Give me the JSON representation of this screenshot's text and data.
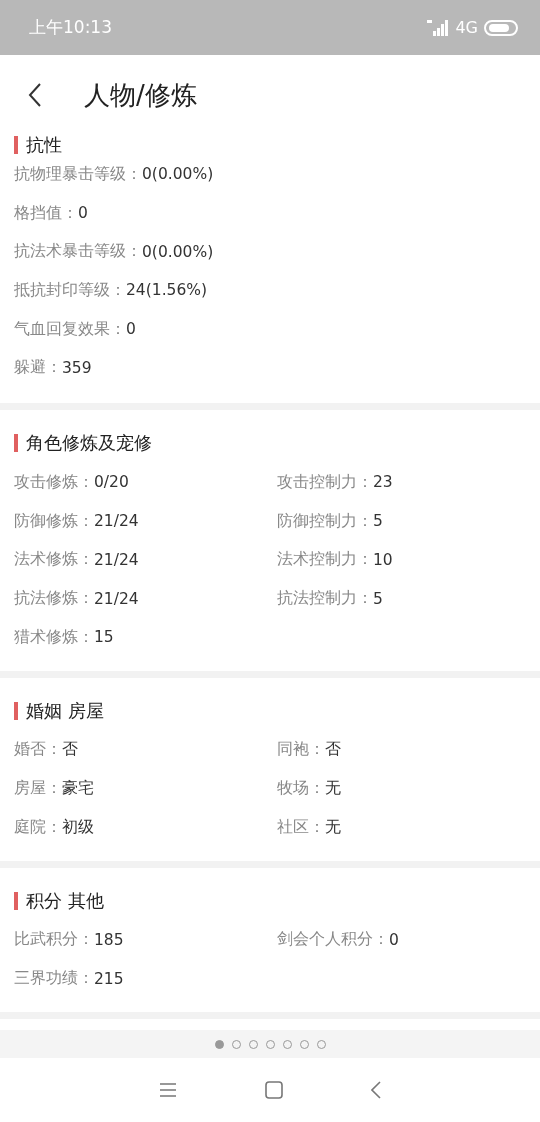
{
  "status_bar": {
    "time": "上午10:13",
    "network": "4G"
  },
  "header": {
    "title": "人物/修炼"
  },
  "sections": [
    {
      "title": "抗性",
      "kind": "list",
      "rows": [
        {
          "label": "抗物理暴击等级：",
          "value": "0(0.00%)"
        },
        {
          "label": "格挡值：",
          "value": "0"
        },
        {
          "label": "抗法术暴击等级：",
          "value": "0(0.00%)"
        },
        {
          "label": "抵抗封印等级：",
          "value": "24(1.56%)"
        },
        {
          "label": "气血回复效果：",
          "value": "0"
        },
        {
          "label": "躲避：",
          "value": "359"
        }
      ]
    },
    {
      "title": "角色修炼及宠修",
      "kind": "grid",
      "rows": [
        {
          "label": "攻击修炼：",
          "value": "0/20"
        },
        {
          "label": "攻击控制力：",
          "value": "23"
        },
        {
          "label": "防御修炼：",
          "value": "21/24"
        },
        {
          "label": "防御控制力：",
          "value": "5"
        },
        {
          "label": "法术修炼：",
          "value": "21/24"
        },
        {
          "label": "法术控制力：",
          "value": "10"
        },
        {
          "label": "抗法修炼：",
          "value": "21/24"
        },
        {
          "label": "抗法控制力：",
          "value": "5"
        },
        {
          "label": "猎术修炼：",
          "value": "15"
        }
      ]
    },
    {
      "title": "婚姻 房屋",
      "kind": "grid",
      "rows": [
        {
          "label": "婚否：",
          "value": "否"
        },
        {
          "label": "同袍：",
          "value": "否"
        },
        {
          "label": "房屋：",
          "value": "豪宅"
        },
        {
          "label": "牧场：",
          "value": "无"
        },
        {
          "label": "庭院：",
          "value": "初级"
        },
        {
          "label": "社区：",
          "value": "无"
        }
      ]
    },
    {
      "title": "积分 其他",
      "kind": "grid",
      "rows": [
        {
          "label": "比武积分：",
          "value": "185"
        },
        {
          "label": "剑会个人积分：",
          "value": "0"
        },
        {
          "label": "三界功绩：",
          "value": "215"
        }
      ]
    }
  ],
  "pager": [
    {
      "selected": true
    },
    {
      "selected": false
    },
    {
      "selected": false
    },
    {
      "selected": false
    },
    {
      "selected": false
    },
    {
      "selected": false
    },
    {
      "selected": false
    }
  ]
}
